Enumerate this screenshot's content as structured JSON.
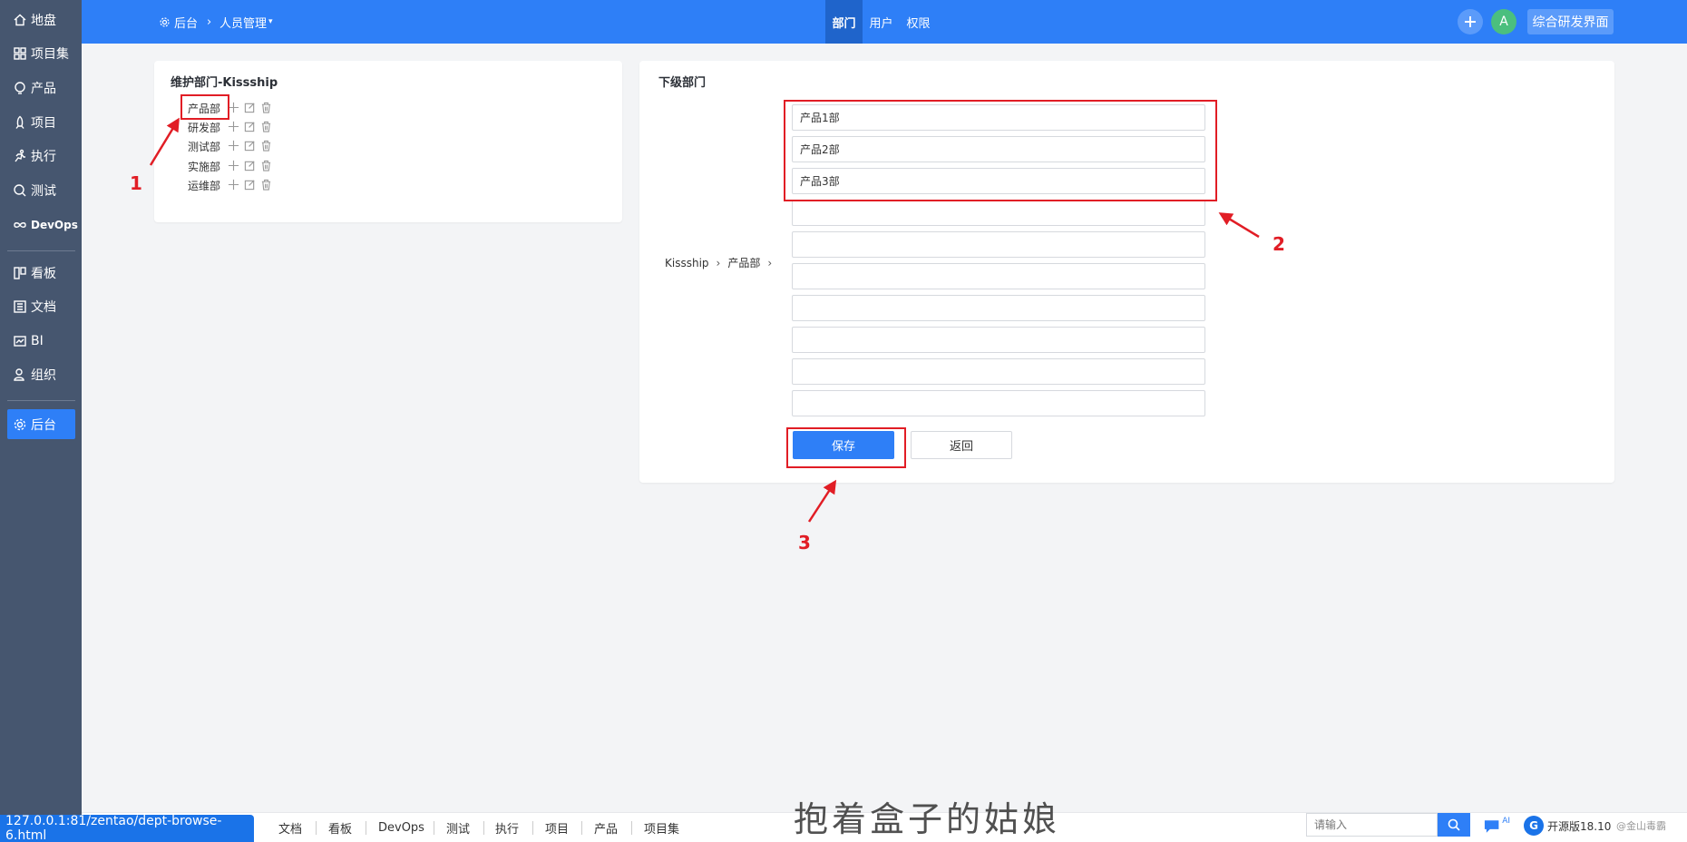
{
  "sidebar": {
    "items": [
      {
        "label": "地盘",
        "icon": "home-icon"
      },
      {
        "label": "项目集",
        "icon": "grid-icon"
      },
      {
        "label": "产品",
        "icon": "lightbulb-icon"
      },
      {
        "label": "项目",
        "icon": "rocket-icon"
      },
      {
        "label": "执行",
        "icon": "run-icon"
      },
      {
        "label": "测试",
        "icon": "search-check-icon"
      },
      {
        "label": "DevOps",
        "icon": "infinity-icon"
      },
      {
        "label": "看板",
        "icon": "kanban-icon"
      },
      {
        "label": "文档",
        "icon": "document-icon"
      },
      {
        "label": "BI",
        "icon": "chart-icon"
      },
      {
        "label": "组织",
        "icon": "people-icon"
      },
      {
        "label": "后台",
        "icon": "gear-icon"
      }
    ],
    "active_color": "#2e7ff7",
    "bg_color": "#46566f"
  },
  "header": {
    "breadcrumb_root": "后台",
    "breadcrumb_current": "人员管理",
    "tabs": [
      {
        "label": "部门",
        "active": true
      },
      {
        "label": "用户",
        "active": false
      },
      {
        "label": "权限",
        "active": false
      }
    ],
    "avatar": "A",
    "workspace": "综合研发界面",
    "bg_color": "#2e7ff7"
  },
  "left_panel": {
    "title": "维护部门-Kissship",
    "departments": [
      "产品部",
      "研发部",
      "测试部",
      "实施部",
      "运维部"
    ]
  },
  "right_panel": {
    "title": "下级部门",
    "path": [
      "Kissship",
      "产品部"
    ],
    "inputs": [
      "产品1部",
      "产品2部",
      "产品3部",
      "",
      "",
      "",
      "",
      "",
      "",
      ""
    ],
    "save_label": "保存",
    "back_label": "返回"
  },
  "annotations": [
    "1",
    "2",
    "3"
  ],
  "bottombar": {
    "url": "127.0.0.1:81/zentao/dept-browse-6.html",
    "links": [
      "文档",
      "看板",
      "DevOps",
      "测试",
      "执行",
      "项目",
      "产品",
      "项目集"
    ],
    "search_placeholder": "请输入",
    "ai_label": "AI",
    "version": "开源版18.10",
    "credit": "@金山毒霸",
    "watermark": "抱着盒子的姑娘"
  }
}
